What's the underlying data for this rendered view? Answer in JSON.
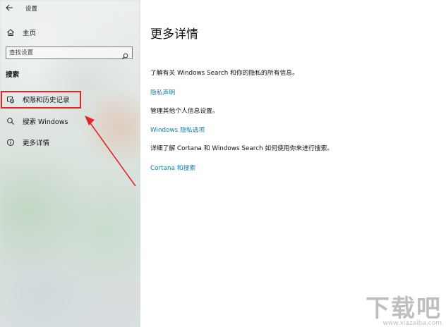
{
  "window": {
    "back_icon": "back-arrow-icon",
    "title": "设置"
  },
  "sidebar": {
    "home": {
      "icon": "home-icon",
      "label": "主页"
    },
    "search": {
      "placeholder": "查找设置",
      "icon": "search-icon"
    },
    "section_title": "搜索",
    "items": [
      {
        "icon": "permissions-history-icon",
        "label": "权限和历史记录",
        "selected": true
      },
      {
        "icon": "search-icon",
        "label": "搜索 Windows",
        "selected": false
      },
      {
        "icon": "info-icon",
        "label": "更多详情",
        "selected": false
      }
    ]
  },
  "main": {
    "title": "更多详情",
    "blocks": [
      {
        "text": "了解有关 Windows Search 和你的隐私的所有信息。",
        "link": "隐私声明"
      },
      {
        "text": "管理其他个人信息设置。",
        "link": "Windows 隐私选项"
      },
      {
        "text": "详细了解 Cortana 和 Windows Search 如何使用你来进行搜索。",
        "link": "Cortana 和搜索"
      }
    ]
  },
  "annotation": {
    "highlight_color": "#e0262a"
  },
  "colors": {
    "link": "#1a7ca8"
  },
  "watermark": {
    "logo": "下载吧",
    "url": "www.xiazaiba.com"
  }
}
